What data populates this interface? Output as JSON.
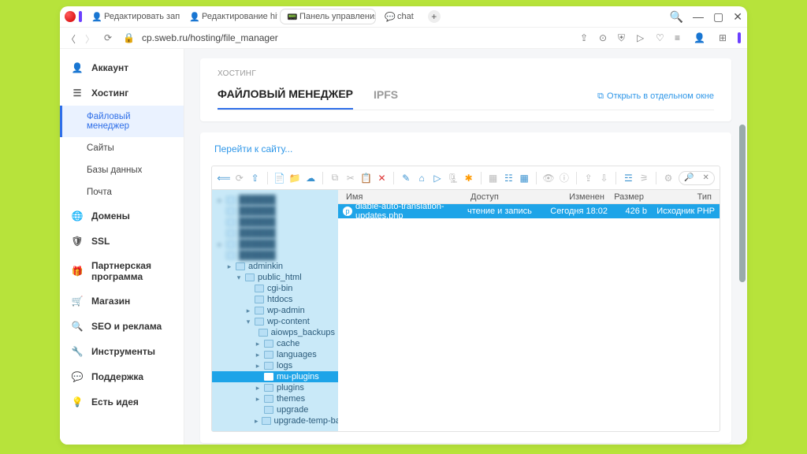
{
  "browser": {
    "tabs": [
      {
        "label": "Редактировать запись \"С"
      },
      {
        "label": "Редактирование hivepre"
      },
      {
        "label": "Панель управления VH",
        "active": true
      },
      {
        "label": "chat"
      }
    ],
    "url": "cp.sweb.ru/hosting/file_manager"
  },
  "sidebar": {
    "account": "Аккаунт",
    "hosting": "Хостинг",
    "hosting_children": [
      {
        "label": "Файловый менеджер",
        "active": true
      },
      {
        "label": "Сайты"
      },
      {
        "label": "Базы данных"
      },
      {
        "label": "Почта"
      }
    ],
    "domains": "Домены",
    "ssl": "SSL",
    "partner": "Партнерская программа",
    "shop": "Магазин",
    "seo": "SEO и реклама",
    "tools": "Инструменты",
    "support": "Поддержка",
    "idea": "Есть идея"
  },
  "page": {
    "crumb": "ХОСТИНГ",
    "tab_fm": "ФАЙЛОВЫЙ МЕНЕДЖЕР",
    "tab_ipfs": "IPFS",
    "open_new": "Открыть в отдельном окне",
    "goto": "Перейти к сайту..."
  },
  "tree": [
    {
      "depth": 0,
      "label": "",
      "blur": true,
      "caret": 1
    },
    {
      "depth": 0,
      "label": "",
      "blur": true
    },
    {
      "depth": 0,
      "label": "",
      "blur": true
    },
    {
      "depth": 0,
      "label": "",
      "blur": true
    },
    {
      "depth": 0,
      "label": "",
      "blur": true,
      "caret": 1
    },
    {
      "depth": 0,
      "label": "",
      "blur": true
    },
    {
      "depth": 1,
      "label": "adminkin",
      "caret": 1
    },
    {
      "depth": 2,
      "label": "public_html",
      "caret": 2
    },
    {
      "depth": 3,
      "label": "cgi-bin"
    },
    {
      "depth": 3,
      "label": "htdocs"
    },
    {
      "depth": 3,
      "label": "wp-admin",
      "caret": 1
    },
    {
      "depth": 3,
      "label": "wp-content",
      "caret": 2
    },
    {
      "depth": 4,
      "label": "aiowps_backups"
    },
    {
      "depth": 4,
      "label": "cache",
      "caret": 1
    },
    {
      "depth": 4,
      "label": "languages",
      "caret": 1
    },
    {
      "depth": 4,
      "label": "logs",
      "caret": 1
    },
    {
      "depth": 4,
      "label": "mu-plugins",
      "sel": true
    },
    {
      "depth": 4,
      "label": "plugins",
      "caret": 1
    },
    {
      "depth": 4,
      "label": "themes",
      "caret": 1
    },
    {
      "depth": 4,
      "label": "upgrade"
    },
    {
      "depth": 4,
      "label": "upgrade-temp-backup",
      "caret": 1
    }
  ],
  "file_table": {
    "columns": {
      "name": "Имя",
      "access": "Доступ",
      "modified": "Изменен",
      "size": "Размер",
      "type": "Тип"
    },
    "rows": [
      {
        "name": "diable-auto-translation-updates.php",
        "access": "чтение и запись",
        "modified": "Сегодня 18:02",
        "size": "426 b",
        "type": "Исходник PHP"
      }
    ]
  }
}
